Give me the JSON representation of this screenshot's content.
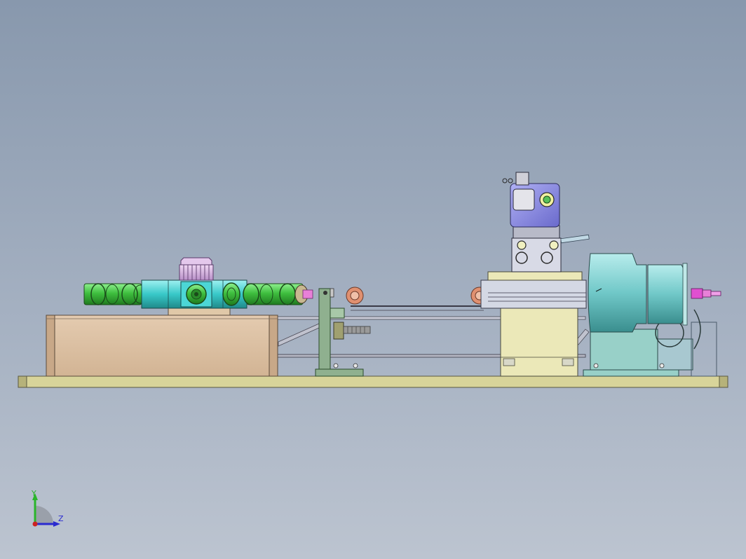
{
  "triad": {
    "y_label": "Y",
    "z_label": "Z",
    "y_color": "#2ab52a",
    "z_color": "#2a2ad0",
    "origin_color": "#cc2222"
  },
  "colors": {
    "background_top": "#8898ad",
    "background_bottom": "#bcc4d0",
    "base_plate": "#d8d49a",
    "housing": "#dcc0a0",
    "green_rollers": "#3fbf3f",
    "turret_hub": "#38c8c8",
    "bracket": "#8fb08f",
    "salmon_rollers": "#e09070",
    "motor_block": "#8888dd",
    "slide_block": "#ebe8b8",
    "spindle": "#70c8c8",
    "spindle_support": "#98d0c8",
    "tool_tip": "#e050d0",
    "gear": "#d8b8e0"
  }
}
